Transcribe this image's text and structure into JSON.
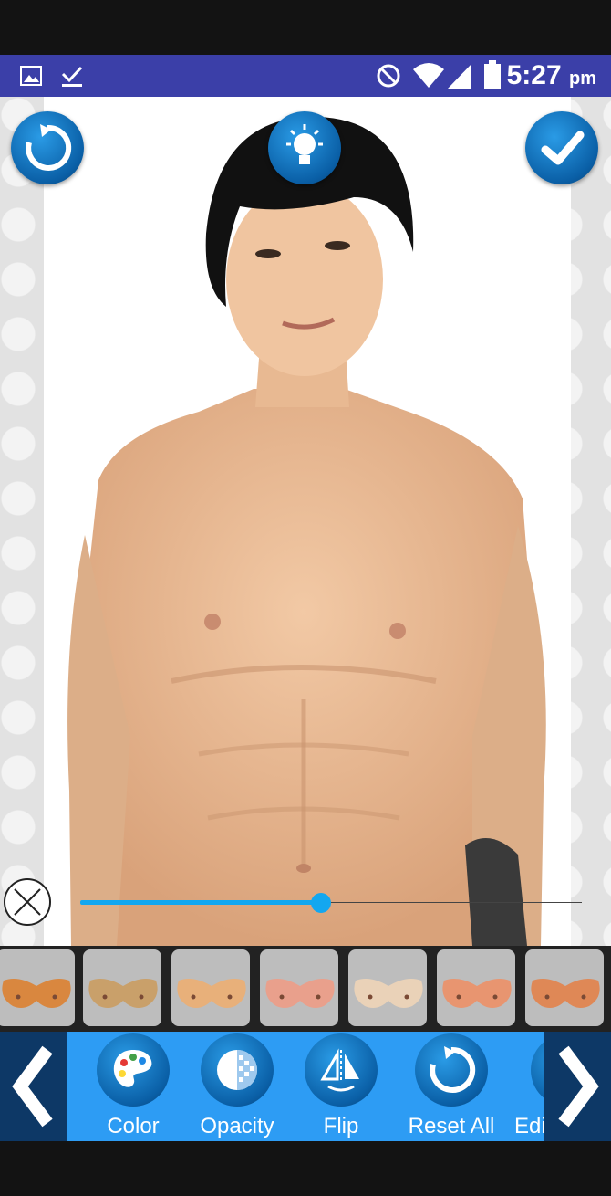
{
  "status_bar": {
    "time": "5:27",
    "ampm": "pm",
    "icons": [
      "image-icon",
      "download-done-icon",
      "do-not-disturb-icon",
      "wifi-icon",
      "signal-icon",
      "battery-icon"
    ]
  },
  "canvas": {
    "top_buttons": [
      "refresh-icon",
      "lightbulb-icon",
      "checkmark-icon"
    ],
    "photo": "shirtless-man-edited-chest-photo"
  },
  "slider": {
    "value": 0.48
  },
  "presets": {
    "items": [
      "chest-preset-1",
      "chest-preset-2",
      "chest-preset-3",
      "chest-preset-4",
      "chest-preset-5",
      "chest-preset-6",
      "chest-preset-7"
    ],
    "colors": [
      "#d9873f",
      "#c9a06a",
      "#e8b07a",
      "#e9a08c",
      "#ead2b8",
      "#e89570",
      "#df8856"
    ]
  },
  "toolbar": {
    "tools": [
      {
        "label": "Color",
        "icon": "palette-icon"
      },
      {
        "label": "Opacity",
        "icon": "opacity-icon"
      },
      {
        "label": "Flip",
        "icon": "flip-icon"
      },
      {
        "label": "Reset All",
        "icon": "reset-icon"
      },
      {
        "label": "Edi",
        "icon": "edit-icon"
      }
    ]
  },
  "colors": {
    "status_bar": "#3b3fa8",
    "toolbar": "#2d9cf4",
    "accent": "#13a7f0",
    "nav_dark": "#0d3866"
  }
}
